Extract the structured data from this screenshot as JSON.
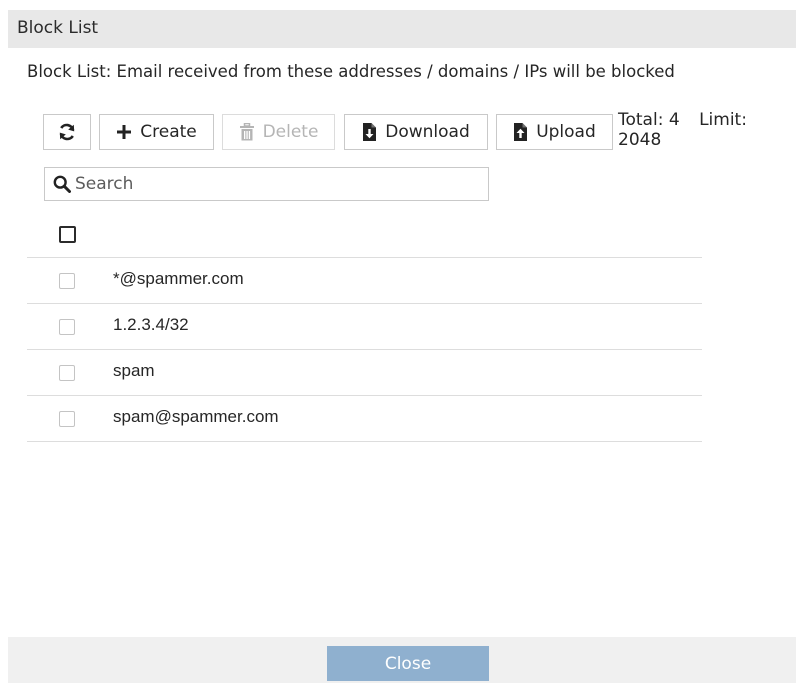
{
  "dialog": {
    "title": "Block List",
    "description": "Block List: Email received from these addresses / domains / IPs will be blocked"
  },
  "toolbar": {
    "refresh_icon": "refresh-icon",
    "create_label": "Create",
    "create_icon": "plus-icon",
    "delete_label": "Delete",
    "delete_icon": "trash-icon",
    "download_label": "Download",
    "download_icon": "file-download-icon",
    "upload_label": "Upload",
    "upload_icon": "file-upload-icon",
    "total_label": "Total: 4",
    "limit_label": "Limit:",
    "limit_value": "2048"
  },
  "search": {
    "placeholder": "Search",
    "value": "",
    "icon": "search-icon"
  },
  "entries": [
    {
      "value": "*@spammer.com",
      "checked": false
    },
    {
      "value": "1.2.3.4/32",
      "checked": false
    },
    {
      "value": "spam",
      "checked": false
    },
    {
      "value": "spam@spammer.com",
      "checked": false
    }
  ],
  "footer": {
    "close_label": "Close"
  },
  "colors": {
    "title_bar": "#e8e8e8",
    "footer": "#f0f0f0",
    "close_button": "#8fb0cf",
    "disabled_text": "#b5b5b5"
  }
}
